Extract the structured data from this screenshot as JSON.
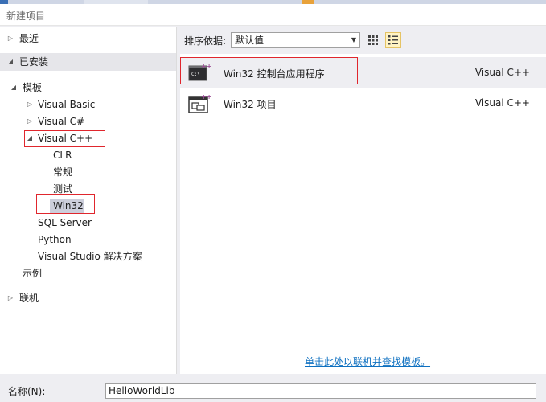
{
  "window": {
    "title": "新建项目"
  },
  "tree": {
    "recent": "最近",
    "installed": "已安装",
    "templates": "模板",
    "visual_basic": "Visual Basic",
    "visual_csharp": "Visual C#",
    "visual_cpp": "Visual C++",
    "clr": "CLR",
    "general": "常规",
    "test": "测试",
    "win32": "Win32",
    "sql_server": "SQL Server",
    "python": "Python",
    "vs_solutions": "Visual Studio 解决方案",
    "samples": "示例",
    "online": "联机"
  },
  "sort": {
    "label": "排序依据:",
    "value": "默认值"
  },
  "templates": [
    {
      "name": "Win32 控制台应用程序",
      "lang": "Visual C++",
      "icon": "console-app-icon"
    },
    {
      "name": "Win32 项目",
      "lang": "Visual C++",
      "icon": "win32-project-icon"
    }
  ],
  "online_link": "单击此处以联机并查找模板。",
  "name_field": {
    "label": "名称(N):",
    "value": "HelloWorldLib"
  },
  "colors": {
    "highlight": "#e0262d",
    "link": "#0e70c0",
    "selection": "#cccedb"
  }
}
